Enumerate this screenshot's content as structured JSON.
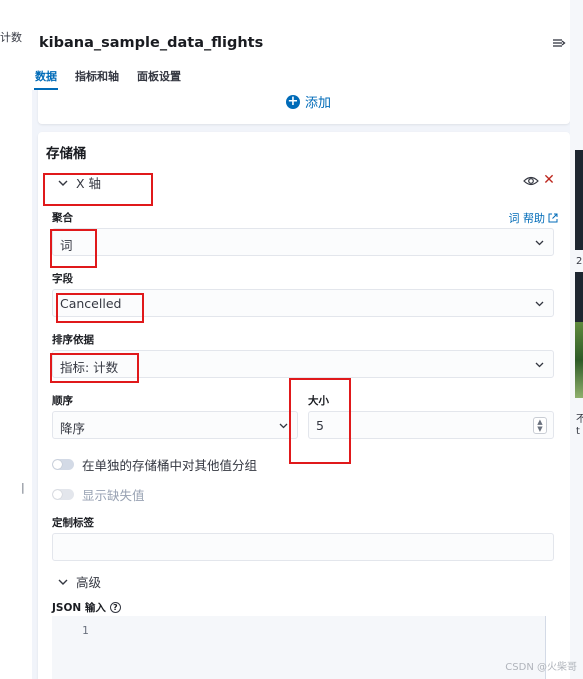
{
  "left_strip": {
    "count_label": "计数",
    "handle": "||"
  },
  "right_strip": {
    "t1": "2",
    "t2": "不",
    "t3": "t"
  },
  "header": {
    "title": "kibana_sample_data_flights",
    "collapse_icon": "collapse-icon"
  },
  "tabs": [
    {
      "label": "数据",
      "active": true
    },
    {
      "label": "指标和轴",
      "active": false
    },
    {
      "label": "面板设置",
      "active": false
    }
  ],
  "add": {
    "label": "添加",
    "icon": "plus-circle-icon"
  },
  "buckets": {
    "title": "存储桶",
    "agg_title": "X 轴",
    "aggregation": {
      "label": "聚合",
      "help": "词 帮助",
      "value": "词"
    },
    "field": {
      "label": "字段",
      "value": "Cancelled"
    },
    "order_by": {
      "label": "排序依据",
      "value": "指标: 计数"
    },
    "order": {
      "label": "顺序",
      "value": "降序"
    },
    "size": {
      "label": "大小",
      "value": "5"
    },
    "group_other": {
      "label": "在单独的存储桶中对其他值分组",
      "enabled": false
    },
    "show_missing": {
      "label": "显示缺失值",
      "enabled": false
    },
    "custom_label": {
      "label": "定制标签",
      "value": ""
    },
    "advanced": {
      "label": "高级"
    },
    "json_input": {
      "label": "JSON 输入",
      "line_number": "1"
    }
  },
  "watermark": "CSDN @火柴哥",
  "colors": {
    "accent": "#006bb8",
    "danger": "#bd271e",
    "highlight": "#e0191b"
  }
}
